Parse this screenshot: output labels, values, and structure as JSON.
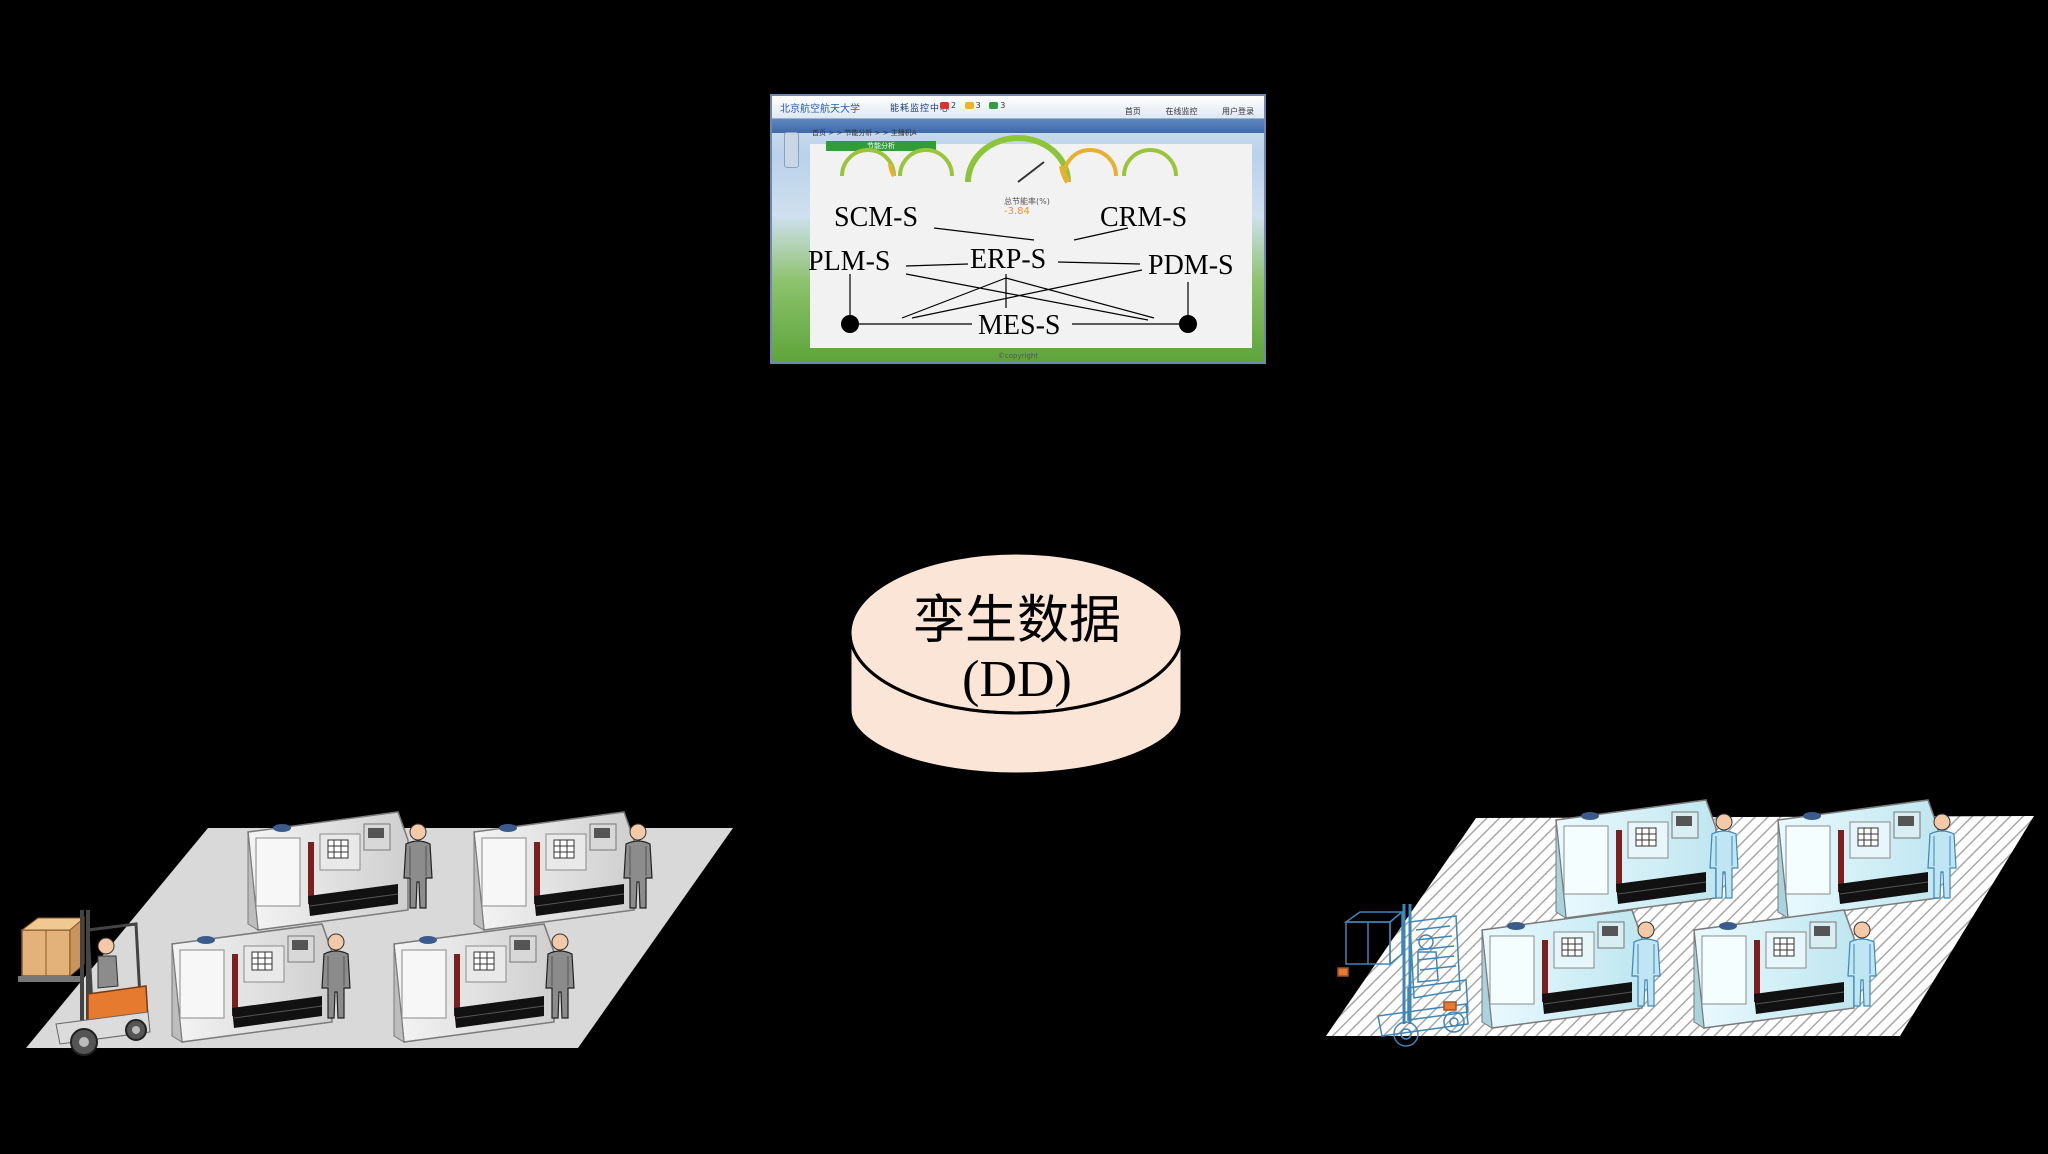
{
  "panel": {
    "logo_text": "北京航空航天大学",
    "app_title": "能耗监控中心",
    "alerts": [
      {
        "count": "2",
        "color": "#d9342b"
      },
      {
        "count": "3",
        "color": "#f0b429"
      },
      {
        "count": "3",
        "color": "#2e9e3f"
      }
    ],
    "menu": [
      "首页",
      "在线监控",
      "用户登录"
    ],
    "breadcrumb": "首页 > > 节能分析 > > 主播机A",
    "tab_label": "节能分析",
    "gauge_value": "-3.84",
    "gauge_caption": "总节能率(%)",
    "copyright": "©copyright"
  },
  "systems": {
    "scm": "SCM-S",
    "crm": "CRM-S",
    "plm": "PLM-S",
    "erp": "ERP-S",
    "pdm": "PDM-S",
    "mes": "MES-S"
  },
  "twin_data": {
    "title": "孪生数据",
    "abbr": "(DD)",
    "fill_color": "#fbe5d6"
  },
  "colors": {
    "background": "#000000",
    "floor_physical": "#d9d9d9",
    "floor_virtual_hatch": "#bfbfbf",
    "machine_body": "#e8e8e8",
    "virtual_tint": "#d6f1f7"
  },
  "icons": [
    "cnc-machine-icon",
    "worker-icon",
    "forklift-icon",
    "gauge-icon"
  ]
}
